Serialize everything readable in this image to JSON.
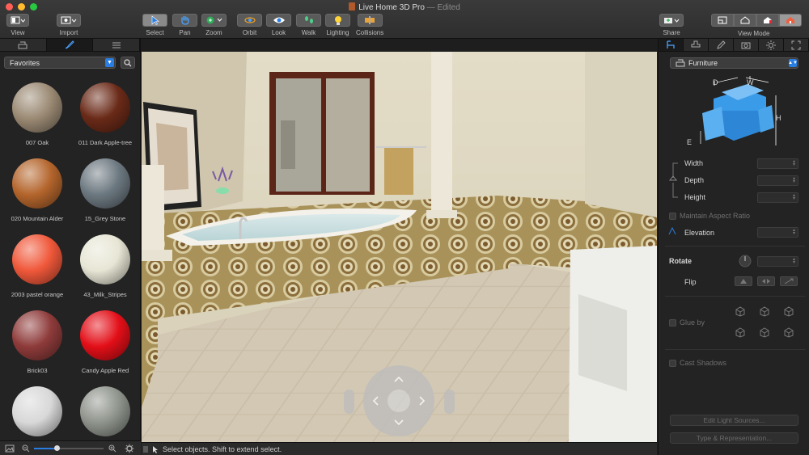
{
  "window": {
    "title": "Live Home 3D Pro",
    "title_suffix": "— Edited",
    "traffic_colors": [
      "#ff5f57",
      "#ffbd2e",
      "#28c940"
    ]
  },
  "toolbar": {
    "view": "View",
    "import": "Import",
    "select": "Select",
    "pan": "Pan",
    "zoom": "Zoom",
    "orbit": "Orbit",
    "look": "Look",
    "walk": "Walk",
    "lighting": "Lighting",
    "collisions": "Collisions",
    "share": "Share",
    "view_mode": "View Mode"
  },
  "library": {
    "category": "Favorites",
    "materials": [
      {
        "name": "007 Oak",
        "color": "#9b8a74"
      },
      {
        "name": "011 Dark Apple-tree",
        "color": "#6a2a18"
      },
      {
        "name": "020 Mountain Alder",
        "color": "#b4652c"
      },
      {
        "name": "15_Grey Stone",
        "color": "#6c7880"
      },
      {
        "name": "2003 pastel orange",
        "color": "#f0583a"
      },
      {
        "name": "43_Milk_Stripes",
        "color": "#e7e6d5"
      },
      {
        "name": "Brick03",
        "color": "#8e3b3a"
      },
      {
        "name": "Candy Apple Red",
        "color": "#e30f18"
      },
      {
        "name": "",
        "color": "#d8d8d8"
      },
      {
        "name": "",
        "color": "#8f948c"
      }
    ]
  },
  "status": {
    "message": "Select objects. Shift to extend select."
  },
  "inspector": {
    "category": "Furniture",
    "dimension_labels": {
      "d": "D",
      "w": "W",
      "h": "H",
      "e": "E"
    },
    "width": "Width",
    "depth": "Depth",
    "height": "Height",
    "maintain_aspect": "Maintain Aspect Ratio",
    "elevation": "Elevation",
    "rotate": "Rotate",
    "flip": "Flip",
    "glue_by": "Glue by",
    "cast_shadows": "Cast Shadows",
    "edit_light_sources": "Edit Light Sources...",
    "type_representation": "Type & Representation..."
  },
  "colors": {
    "accent": "#2a7de1",
    "selected_icon": "#4aa3ff"
  }
}
